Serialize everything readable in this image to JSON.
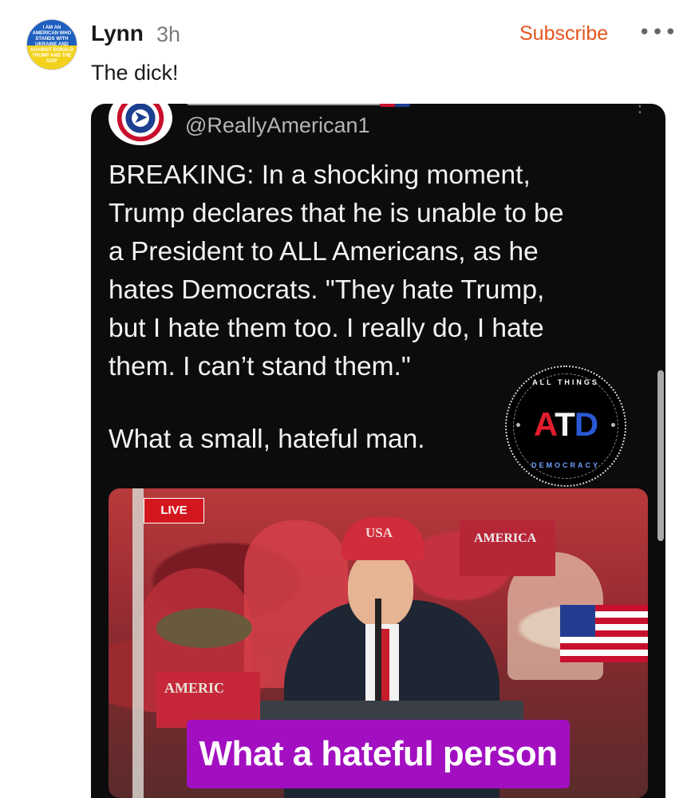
{
  "post": {
    "avatar_text": "I AM AN AMERICAN WHO STANDS WITH UKRAINE AND AGAINST DONALD TRUMP AND THE GOP",
    "author": "Lynn",
    "time": "3h",
    "subscribe_label": "Subscribe",
    "more_label": "•••",
    "text": "The dick!"
  },
  "embed": {
    "handle": "@ReallyAmerican1",
    "body": "BREAKING: In a shocking moment,\nTrump declares that he is unable to be\na President to ALL Americans, as he\nhates Democrats. \"They hate Trump,\nbut I hate them too. I really do, I hate\nthem. I can’t stand them.\"",
    "closing": "What a small, hateful man.",
    "logo": {
      "top": "ALL THINGS",
      "a": "A",
      "t": "T",
      "d": "D",
      "bottom": "DEMOCRACY"
    },
    "video": {
      "live_label": "LIVE",
      "hat_text": "USA",
      "sign_1": "AMERIC",
      "sign_2": "AMERICA",
      "caption": "What a hateful person"
    }
  },
  "colors": {
    "subscribe": "#e4561f",
    "live": "#d3171f",
    "caption_bg": "#a20fc0"
  }
}
